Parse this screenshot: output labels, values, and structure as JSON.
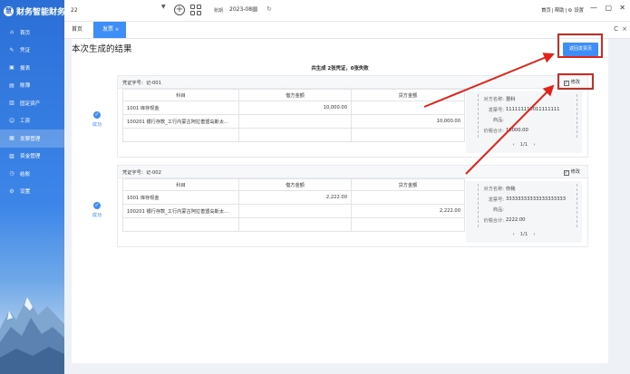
{
  "app": {
    "logo_text": "财务智能财务",
    "logo_mark": "慧"
  },
  "sidebar": {
    "items": [
      {
        "label": "首页",
        "icon": "⌂",
        "icon_name": "home-icon"
      },
      {
        "label": "凭证",
        "icon": "✎",
        "icon_name": "voucher-icon"
      },
      {
        "label": "报表",
        "icon": "▣",
        "icon_name": "chart-icon"
      },
      {
        "label": "账簿",
        "icon": "▤",
        "icon_name": "book-icon"
      },
      {
        "label": "固定资产",
        "icon": "▥",
        "icon_name": "asset-icon"
      },
      {
        "label": "工资",
        "icon": "☺",
        "icon_name": "salary-icon"
      },
      {
        "label": "发票管理",
        "icon": "▦",
        "icon_name": "invoice-icon",
        "active": true
      },
      {
        "label": "资金管理",
        "icon": "▧",
        "icon_name": "fund-icon"
      },
      {
        "label": "结账",
        "icon": "◷",
        "icon_name": "close-period-icon"
      },
      {
        "label": "设置",
        "icon": "⚙",
        "icon_name": "settings-icon"
      }
    ]
  },
  "topbar": {
    "org_value": "22",
    "period_label": "账期",
    "period_value": "2023-08",
    "links": [
      "首页",
      "帮助",
      "设置"
    ],
    "settings_icon": "⚙",
    "win_min": "—",
    "win_max": "▢",
    "win_close": "✕"
  },
  "tabs": {
    "home": "首页",
    "invoice": "发票",
    "close": "×",
    "refresh": "C",
    "close_all": "×"
  },
  "page": {
    "title": "本次生成的结果",
    "return_button": "返回发票页",
    "summary": "共生成 2张凭证，0张失败"
  },
  "vouchers": [
    {
      "status": "成功",
      "voucher_no": "凭证字号：记-001",
      "edit_label": "修改",
      "headers": [
        "科目",
        "借方金额",
        "贷方金额"
      ],
      "rows": [
        {
          "account": "1001 库存现金",
          "debit": "10,000.00",
          "credit": ""
        },
        {
          "account": "100201 银行存款_工行内蒙古阿拉善盟岛斯太...",
          "debit": "",
          "credit": "10,000.00"
        },
        {
          "account": "",
          "debit": "",
          "credit": ""
        }
      ],
      "invoice": {
        "seller_label": "对方名称:",
        "seller": "慧科",
        "number_label": "发票号:",
        "number": "111111110011111111",
        "goods_label": "商品:",
        "goods": "",
        "total_label": "价税合计:",
        "total": "10000.00"
      },
      "pager": {
        "prev": "‹",
        "text": "1/1",
        "next": "›"
      }
    },
    {
      "status": "成功",
      "voucher_no": "凭证字号：记-002",
      "edit_label": "修改",
      "headers": [
        "科目",
        "借方金额",
        "贷方金额"
      ],
      "rows": [
        {
          "account": "1001 库存现金",
          "debit": "2,222.00",
          "credit": ""
        },
        {
          "account": "100201 银行存款_工行内蒙古阿拉善盟岛斯太...",
          "debit": "",
          "credit": "2,222.00"
        },
        {
          "account": "",
          "debit": "",
          "credit": ""
        }
      ],
      "invoice": {
        "seller_label": "对方名称:",
        "seller": "你我",
        "number_label": "发票号:",
        "number": "33333333333333333333",
        "goods_label": "商品:",
        "goods": "",
        "total_label": "价税合计:",
        "total": "2222.00"
      },
      "pager": {
        "prev": "‹",
        "text": "1/1",
        "next": "›"
      }
    }
  ],
  "colors": {
    "accent": "#3e8ef7",
    "sidebar": "#2b6fd6",
    "annotation": "#e2231a"
  }
}
